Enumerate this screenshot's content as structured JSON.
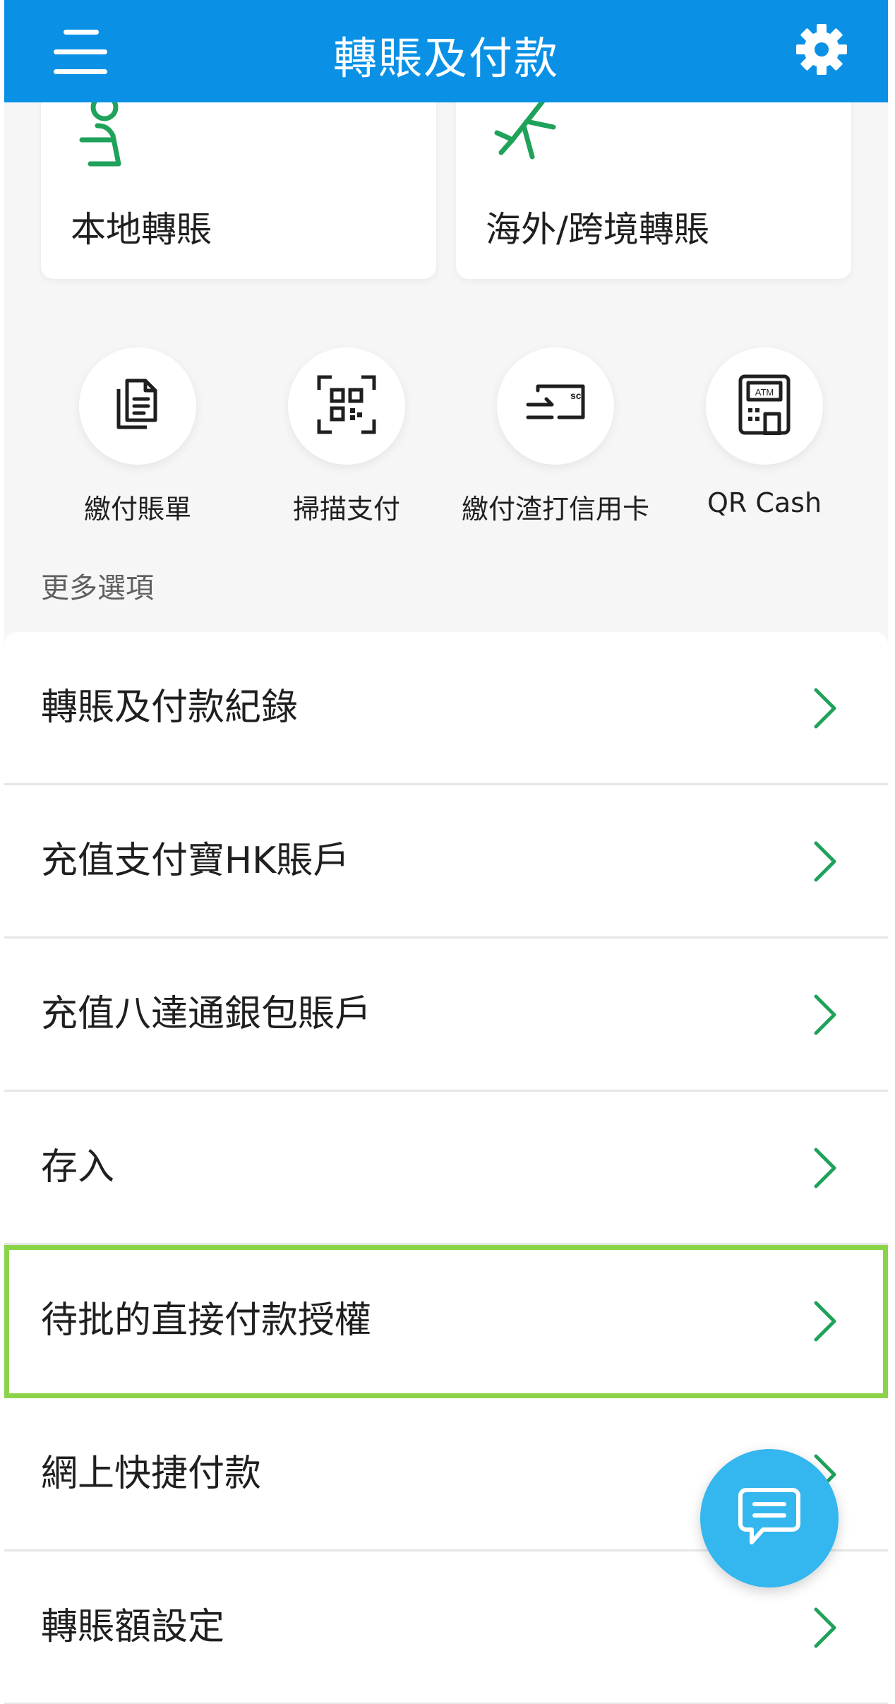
{
  "header": {
    "title": "轉賬及付款",
    "menu_icon": "hamburger-menu-icon",
    "settings_icon": "gear-icon",
    "bg_color": "#0a91e6"
  },
  "cards": [
    {
      "label": "本地轉賬",
      "icon": "local-transfer-icon"
    },
    {
      "label": "海外/跨境轉賬",
      "icon": "airplane-icon"
    }
  ],
  "quick_actions": [
    {
      "label": "繳付賬單",
      "icon": "bill-document-icon"
    },
    {
      "label": "掃描支付",
      "icon": "qr-scan-icon"
    },
    {
      "label": "繳付渣打信用卡",
      "icon": "sc-credit-card-icon",
      "icon_text": "sc"
    },
    {
      "label": "QR Cash",
      "icon": "atm-icon",
      "icon_text": "ATM"
    }
  ],
  "more_options": {
    "title": "更多選項",
    "items": [
      {
        "label": "轉賬及付款紀錄"
      },
      {
        "label": "充值支付寶HK賬戶"
      },
      {
        "label": "充值八達通銀包賬戶"
      },
      {
        "label": "存入"
      },
      {
        "label": "待批的直接付款授權"
      },
      {
        "label": "網上快捷付款"
      },
      {
        "label": "轉賬額設定"
      }
    ],
    "highlighted_index": 4
  },
  "colors": {
    "accent_green": "#1fa25a",
    "highlight_border": "#8bd44a",
    "chat_fab": "#34b6ef"
  },
  "chat_icon": "chat-bubble-icon"
}
